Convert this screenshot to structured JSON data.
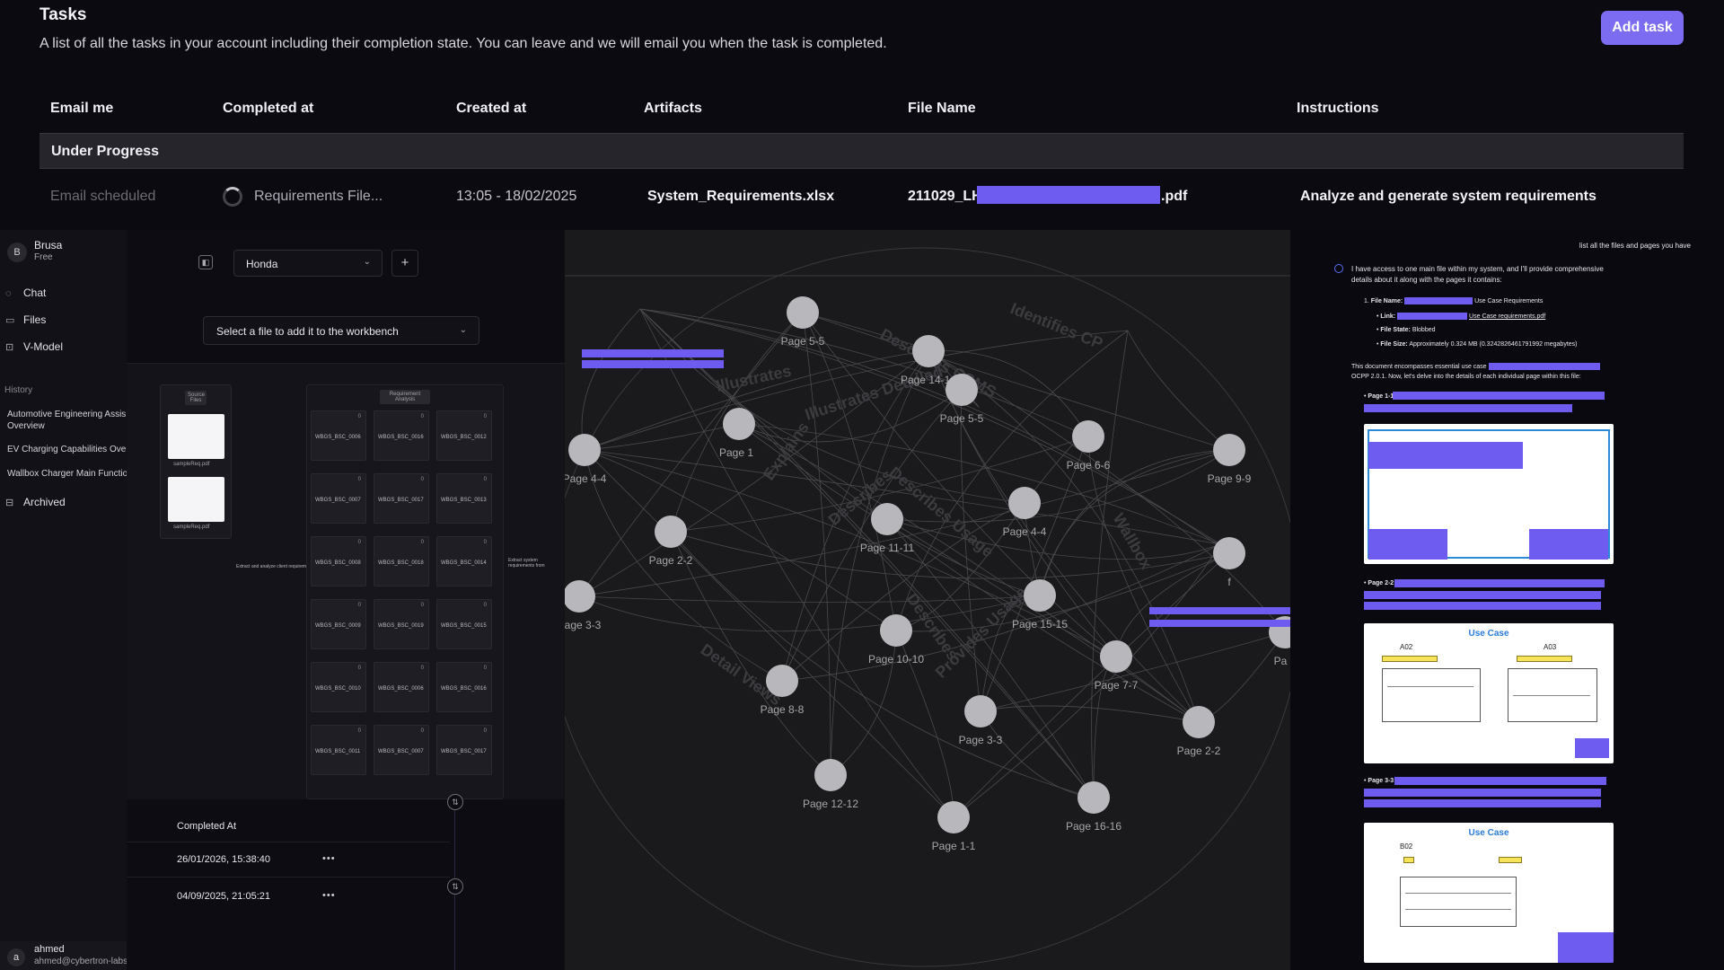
{
  "tasks": {
    "title": "Tasks",
    "description": "A list of all the tasks in your account including their completion state. You can leave and we will email you when the task is completed.",
    "add_label": "Add task",
    "columns": [
      "Email me",
      "Completed at",
      "Created at",
      "Artifacts",
      "File Name",
      "Instructions"
    ],
    "group_label": "Under Progress",
    "row": {
      "email": "Email scheduled",
      "completed": "Requirements File...",
      "created": "13:05 - 18/02/2025",
      "artifact": "System_Requirements.xlsx",
      "file_prefix": "211029_LH",
      "file_suffix": ".pdf",
      "instructions": "Analyze and generate system requirements"
    }
  },
  "sidebar": {
    "account_initial": "B",
    "account_name": "Brusa",
    "account_plan": "Free",
    "nav": [
      {
        "label": "Chat",
        "icon": "chat-icon"
      },
      {
        "label": "Files",
        "icon": "files-icon"
      },
      {
        "label": "V-Model",
        "icon": "v-model-icon"
      }
    ],
    "history_label": "History",
    "history": [
      "Automotive Engineering Assis Overview",
      "EV Charging Capabilities Ove",
      "Wallbox Charger Main Functio"
    ],
    "archived_label": "Archived",
    "user_initial": "a",
    "user_name": "ahmed",
    "user_email": "ahmed@cybertron-labs"
  },
  "workbench": {
    "project": "Honda",
    "file_placeholder": "Select a file to add it to the workbench",
    "source_tag": "Source Files",
    "docs": [
      "sampleReq.pdf",
      "sampleReq.pdf"
    ],
    "req_tag": "Requirement Analysis",
    "extract_note": "Extract and analyze client requirements",
    "extract_note2": "Extract system requirements from",
    "requirements": [
      {
        "id": "WBGS_BSC_0006",
        "n": "0"
      },
      {
        "id": "WBGS_BSC_0016",
        "n": "0"
      },
      {
        "id": "WBGS_BSC_0012",
        "n": "0"
      },
      {
        "id": "WBGS_BSC_0007",
        "n": "0"
      },
      {
        "id": "WBGS_BSC_0017",
        "n": "0"
      },
      {
        "id": "WBGS_BSC_0013",
        "n": "0"
      },
      {
        "id": "WBGS_BSC_0008",
        "n": "0"
      },
      {
        "id": "WBGS_BSC_0018",
        "n": "0"
      },
      {
        "id": "WBGS_BSC_0014",
        "n": "0"
      },
      {
        "id": "WBGS_BSC_0009",
        "n": "0"
      },
      {
        "id": "WBGS_BSC_0019",
        "n": "0"
      },
      {
        "id": "WBGS_BSC_0015",
        "n": "0"
      },
      {
        "id": "WBGS_BSC_0010",
        "n": "0"
      },
      {
        "id": "WBGS_BSC_0006",
        "n": "0"
      },
      {
        "id": "WBGS_BSC_0016",
        "n": "0"
      },
      {
        "id": "WBGS_BSC_0011",
        "n": "0"
      },
      {
        "id": "WBGS_BSC_0007",
        "n": "0"
      },
      {
        "id": "WBGS_BSC_0017",
        "n": "0"
      }
    ],
    "completed_header": "Completed At",
    "completed_rows": [
      "26/01/2026, 15:38:40",
      "04/09/2025, 21:05:21"
    ],
    "row_menu": "•••"
  },
  "graph": {
    "nodes": [
      "Page 5-5",
      "Page 14-14",
      "Page 5-5",
      "Page 1",
      "Page 4-4",
      "Page 6-6",
      "Page 9-9",
      "Page 4-4",
      "Page 11-11",
      "Page 2-2",
      "Page 3-3",
      "Page 15-15",
      "Page 10-10",
      "Page 7-7",
      "Page 8-8",
      "Page 3-3",
      "Page 2-2",
      "Page 12-12",
      "Page 16-16",
      "Page 1-1",
      "Pa",
      "f"
    ],
    "edge_labels": [
      "Describes CSMS",
      "Identifies CP",
      "Illustrates",
      "Illustrates Detailed",
      "Describes Usage",
      "Explains",
      "Describes",
      "Detail Views",
      "Describes",
      "Provides Usage",
      "Wallbox"
    ]
  },
  "chat": {
    "user_message": "list all the files and pages you have",
    "intro": "I have access to one main file within my system, and I'll provide comprehensive details about it along with the pages it contains:",
    "file_name_label": "File Name:",
    "file_name_value": "Use Case Requirements",
    "link_label": "Link:",
    "link_value": "Use Case requirements.pdf",
    "state_label": "File State:",
    "state_value": "Blobbed",
    "size_label": "File Size:",
    "size_value": "Approximately 0.324 MB (0.3242826461791992 megabytes)",
    "summary_prefix": "This document encompasses essential use case",
    "summary_suffix": "OCPP 2.0.1. Now, let's delve into the details of each individual page within this file:",
    "page_labels": [
      "Page 1-1:",
      "Page 2-2:",
      "Page 3-3:"
    ],
    "uc_title": "Use Case",
    "uc_codes": [
      "A02",
      "A03",
      "B02"
    ]
  },
  "colors": {
    "accent": "#7b6cf2",
    "redaction": "#6e5cf0",
    "node": "#b8b8bc"
  }
}
